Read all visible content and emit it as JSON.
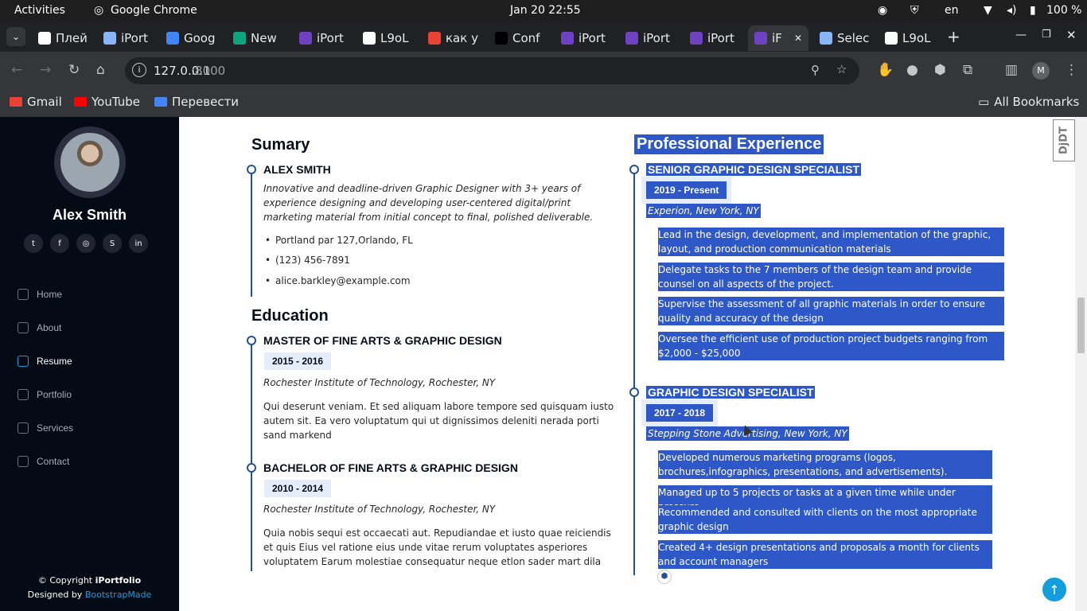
{
  "os_bar": {
    "activities": "Activities",
    "app_name": "Google Chrome",
    "clock": "Jan 20  22:55",
    "lang": "en",
    "battery": "100 %"
  },
  "tabs": [
    {
      "label": "Плей",
      "color": "#ffffff"
    },
    {
      "label": "iPort",
      "color": "#8ab4f8"
    },
    {
      "label": "Goog",
      "color": "#4285f4"
    },
    {
      "label": "New",
      "color": "#10a37f"
    },
    {
      "label": "iPort",
      "color": "#6f42c1"
    },
    {
      "label": "L9oL",
      "color": "#ffffff"
    },
    {
      "label": "как у",
      "color": "#ea4335"
    },
    {
      "label": "Conf",
      "color": "#000000"
    },
    {
      "label": "iPort",
      "color": "#6f42c1"
    },
    {
      "label": "iPort",
      "color": "#6f42c1"
    },
    {
      "label": "iPort",
      "color": "#6f42c1"
    },
    {
      "label": "iF",
      "color": "#6f42c1",
      "active": true
    },
    {
      "label": "Selec",
      "color": "#8ab4f8"
    },
    {
      "label": "L9oL",
      "color": "#ffffff"
    }
  ],
  "omnibox": {
    "url_host": "127.0.0.1",
    "url_port": ":8000"
  },
  "bookmarks": [
    {
      "label": "Gmail",
      "color": "#ea4335"
    },
    {
      "label": "YouTube",
      "color": "#ff0000"
    },
    {
      "label": "Перевести",
      "color": "#4285f4"
    }
  ],
  "all_bookmarks": "All Bookmarks",
  "profile": {
    "name": "Alex Smith"
  },
  "socials": [
    "twitter",
    "facebook",
    "instagram",
    "skype",
    "linkedin"
  ],
  "nav": [
    {
      "label": "Home",
      "icon": "house-icon"
    },
    {
      "label": "About",
      "icon": "person-icon"
    },
    {
      "label": "Resume",
      "icon": "file-icon",
      "active": true
    },
    {
      "label": "Portfolio",
      "icon": "book-icon"
    },
    {
      "label": "Services",
      "icon": "server-icon"
    },
    {
      "label": "Contact",
      "icon": "envelope-icon"
    }
  ],
  "footer": {
    "copyright": "© Copyright ",
    "brand": "iPortfolio",
    "designed": "Designed by ",
    "designer": "BootstrapMade"
  },
  "summary": {
    "title": "Sumary",
    "name": "ALEX SMITH",
    "desc": "Innovative and deadline-driven Graphic Designer with 3+ years of experience designing and developing user-centered digital/print marketing material from initial concept to final, polished deliverable.",
    "items": [
      "Portland par 127,Orlando, FL",
      "(123) 456-7891",
      "alice.barkley@example.com"
    ]
  },
  "education": {
    "title": "Education",
    "entries": [
      {
        "degree": "MASTER OF FINE ARTS & GRAPHIC DESIGN",
        "period": "2015 - 2016",
        "school": "Rochester Institute of Technology, Rochester, NY",
        "desc": "Qui deserunt veniam. Et sed aliquam labore tempore sed quisquam iusto autem sit. Ea vero voluptatum qui ut dignissimos deleniti nerada porti sand markend"
      },
      {
        "degree": "BACHELOR OF FINE ARTS & GRAPHIC DESIGN",
        "period": "2010 - 2014",
        "school": "Rochester Institute of Technology, Rochester, NY",
        "desc": "Quia nobis sequi est occaecati aut. Repudiandae et iusto quae reiciendis et quis Eius vel ratione eius unde vitae rerum voluptates asperiores voluptatem Earum molestiae consequatur neque etlon sader mart dila"
      }
    ]
  },
  "experience": {
    "title": "Professional Experience",
    "jobs": [
      {
        "role": "SENIOR GRAPHIC DESIGN SPECIALIST",
        "period": "2019 - Present",
        "place": "Experion, New York, NY",
        "bullets": [
          "Lead in the design, development, and implementation of the graphic, layout, and production communication materials",
          "Delegate tasks to the 7 members of the design team and provide counsel on all aspects of the project.",
          "Supervise the assessment of all graphic materials in order to ensure quality and accuracy of the design",
          "Oversee the efficient use of production project budgets ranging from $2,000 - $25,000"
        ]
      },
      {
        "role": "GRAPHIC DESIGN SPECIALIST",
        "period": "2017 - 2018",
        "place": "Stepping Stone Advertising, New York, NY",
        "bullets": [
          "Developed numerous marketing programs (logos, brochures,infographics, presentations, and advertisements).",
          "Managed up to 5 projects or tasks at a given time while under pressure",
          "Recommended and consulted with clients on the most appropriate graphic design",
          "Created 4+ design presentations and proposals a month for clients and account managers"
        ]
      }
    ]
  },
  "djdt": "DjDT"
}
